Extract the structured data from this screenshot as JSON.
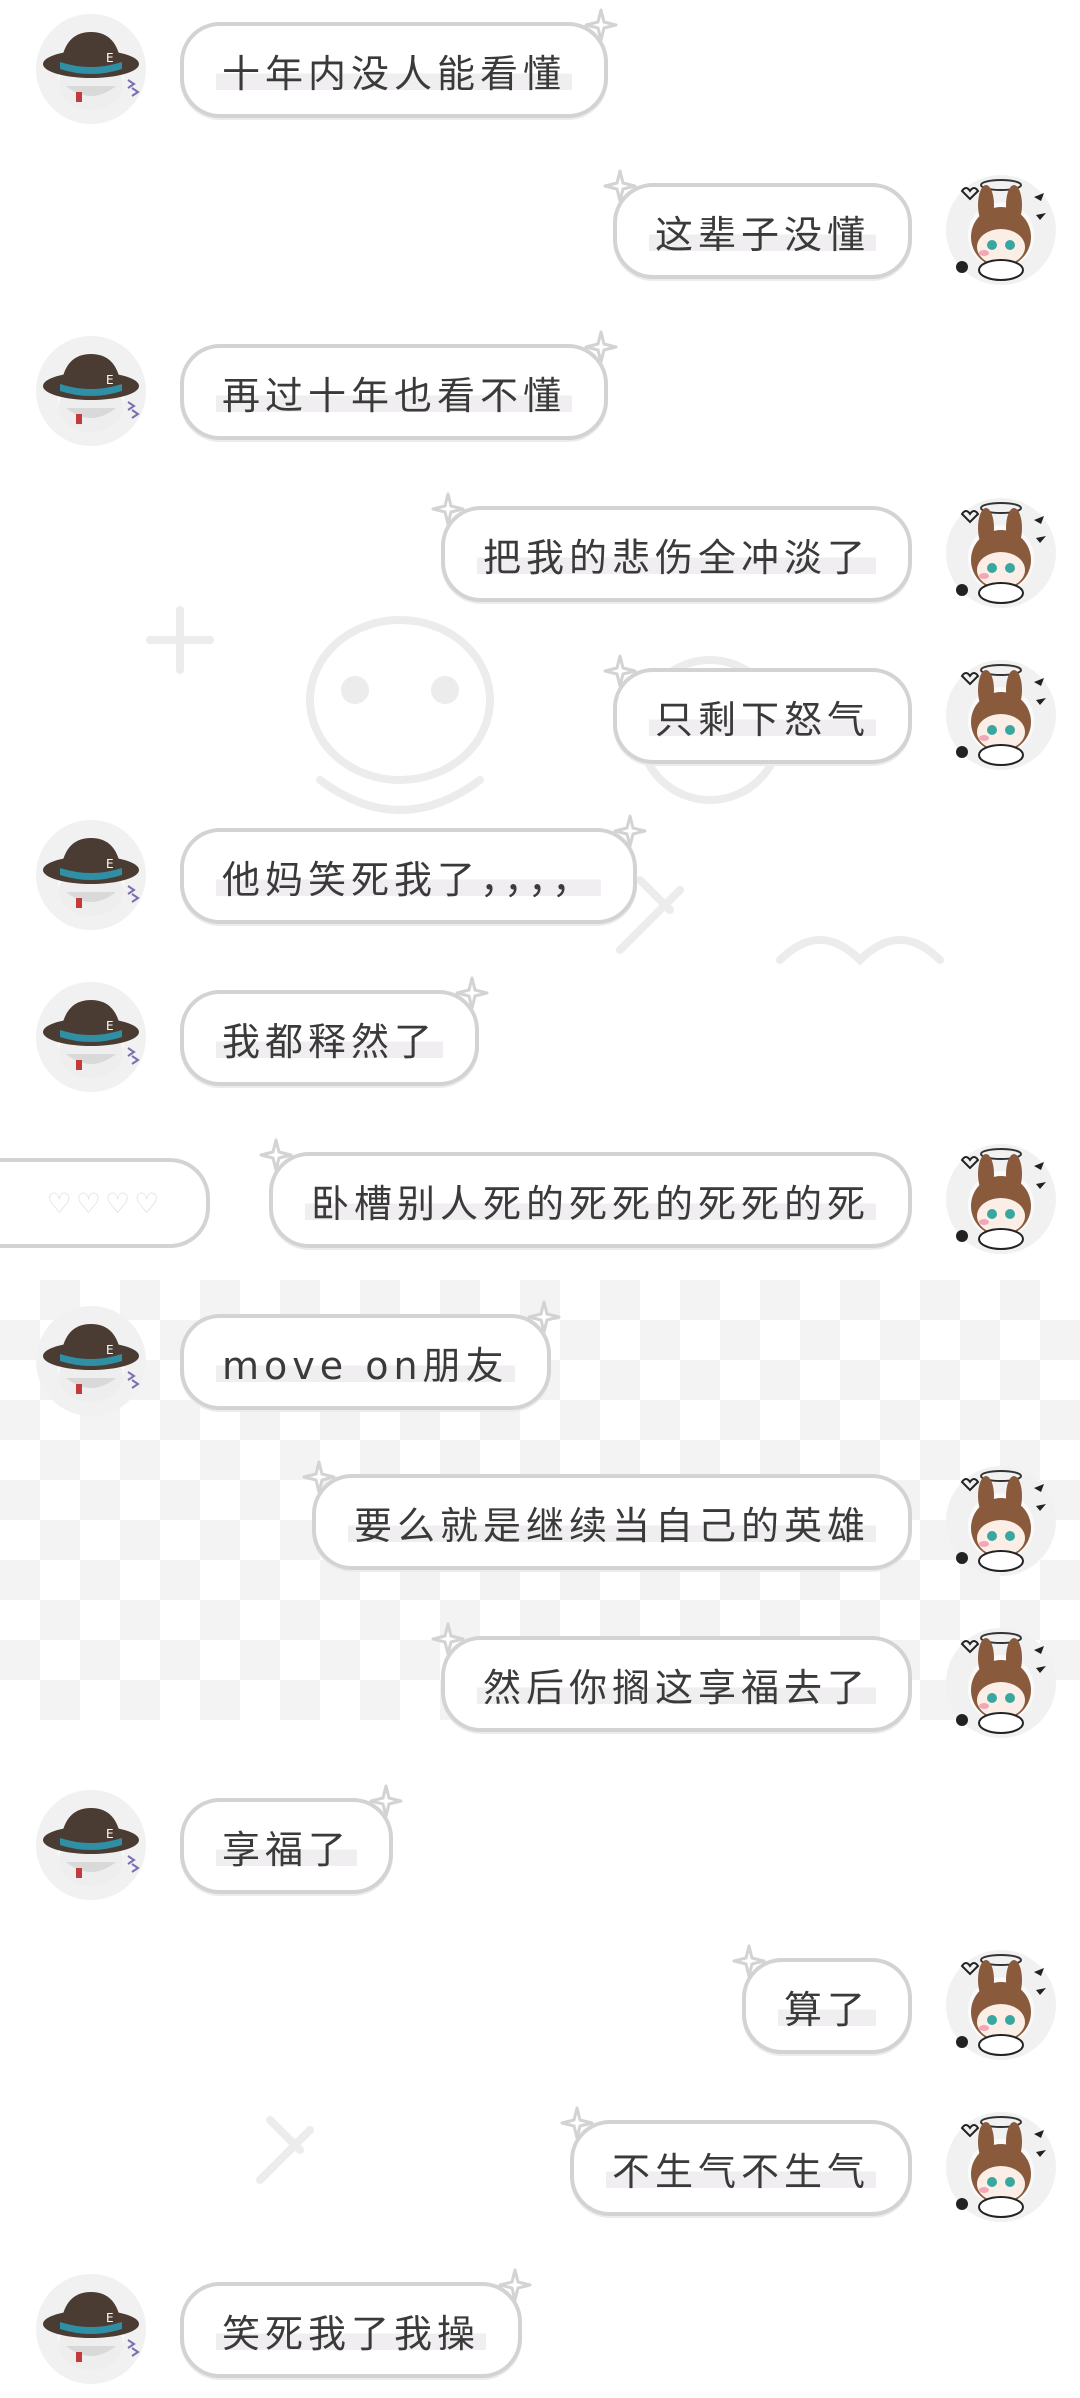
{
  "colors": {
    "bubble_border": "#d3d3d3",
    "text": "#3a3a3a",
    "other_hat": "#4a3b33",
    "other_hat_band": "#2f8fa5",
    "self_hair": "#8a5a3c",
    "self_eye": "#3aa6a0"
  },
  "icons": {
    "bubble_decoration": "sparkle-star-icon",
    "other_avatar": "hat-character-avatar",
    "self_avatar": "bunny-ear-character-avatar"
  },
  "messages": [
    {
      "side": "left",
      "text": "十年内没人能看懂"
    },
    {
      "side": "right",
      "text": "这辈子没懂"
    },
    {
      "side": "left",
      "text": "再过十年也看不懂"
    },
    {
      "side": "right",
      "text": "把我的悲伤全冲淡了"
    },
    {
      "side": "right",
      "text": "只剩下怒气"
    },
    {
      "side": "left",
      "text": "他妈笑死我了，，，，"
    },
    {
      "side": "left",
      "text": "我都释然了"
    },
    {
      "side": "right",
      "text": "卧槽别人死的死死的死死的死"
    },
    {
      "side": "left",
      "text": "move on朋友"
    },
    {
      "side": "right",
      "text": "要么就是继续当自己的英雄"
    },
    {
      "side": "right",
      "text": "然后你搁这享福去了"
    },
    {
      "side": "left",
      "text": "享福了"
    },
    {
      "side": "right",
      "text": "算了"
    },
    {
      "side": "right",
      "text": "不生气不生气"
    },
    {
      "side": "left",
      "text": "笑死我了我操"
    }
  ]
}
